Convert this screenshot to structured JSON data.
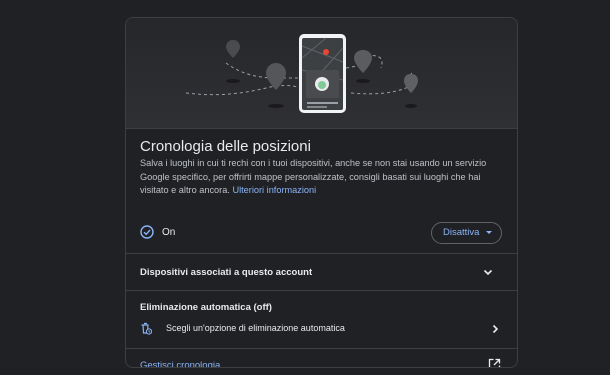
{
  "card": {
    "title": "Cronologia delle posizioni",
    "description": "Salva i luoghi in cui ti rechi con i tuoi dispositivi, anche se non stai usando un servizio Google specifico, per offrirti mappe personalizzate, consigli basati sui luoghi che hai visitato e altro ancora.",
    "learn_more": "Ulteriori informazioni"
  },
  "status": {
    "icon": "check-circle-icon",
    "label": "On",
    "action_label": "Disattiva"
  },
  "devices": {
    "label": "Dispositivi associati a questo account",
    "icon": "chevron-down-icon"
  },
  "auto_delete": {
    "label": "Eliminazione automatica (off)",
    "option_label": "Scegli un'opzione di eliminazione automatica",
    "icon": "auto-delete-icon"
  },
  "footer": {
    "manage_label": "Gestisci cronologia",
    "icon": "open-in-new-icon"
  },
  "colors": {
    "background": "#202124",
    "accent": "#8ab4f8",
    "text": "#e8eaed",
    "muted_text": "#bdc1c6",
    "divider": "#3c4043"
  }
}
